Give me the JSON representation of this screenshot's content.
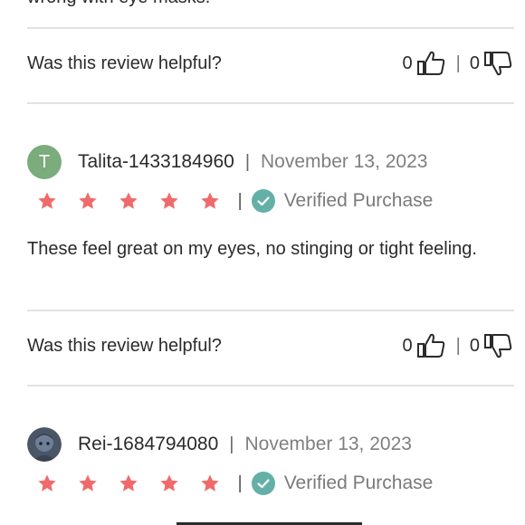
{
  "prev_review": {
    "clipped_text": "wrong with eye masks.",
    "helpful_question": "Was this review helpful?",
    "upvotes": "0",
    "downvotes": "0"
  },
  "reviews": [
    {
      "avatar_letter": "T",
      "avatar_color": "#7aac7c",
      "name": "Talita-1433184960",
      "date": "November 13, 2023",
      "rating": 5,
      "verified_label": "Verified Purchase",
      "body": "These feel great on my eyes, no stinging or tight feeling.",
      "helpful_question": "Was this review helpful?",
      "upvotes": "0",
      "downvotes": "0"
    },
    {
      "avatar_letter": "",
      "name": "Rei-1684794080",
      "date": "November 13, 2023",
      "rating": 5,
      "verified_label": "Verified Purchase"
    }
  ],
  "colors": {
    "star": "#f06a6a",
    "verified": "#64b0a8",
    "divider": "#e3e3e3"
  },
  "icons": [
    "thumbs-up-icon",
    "thumbs-down-icon",
    "star-icon",
    "verified-check-icon"
  ]
}
